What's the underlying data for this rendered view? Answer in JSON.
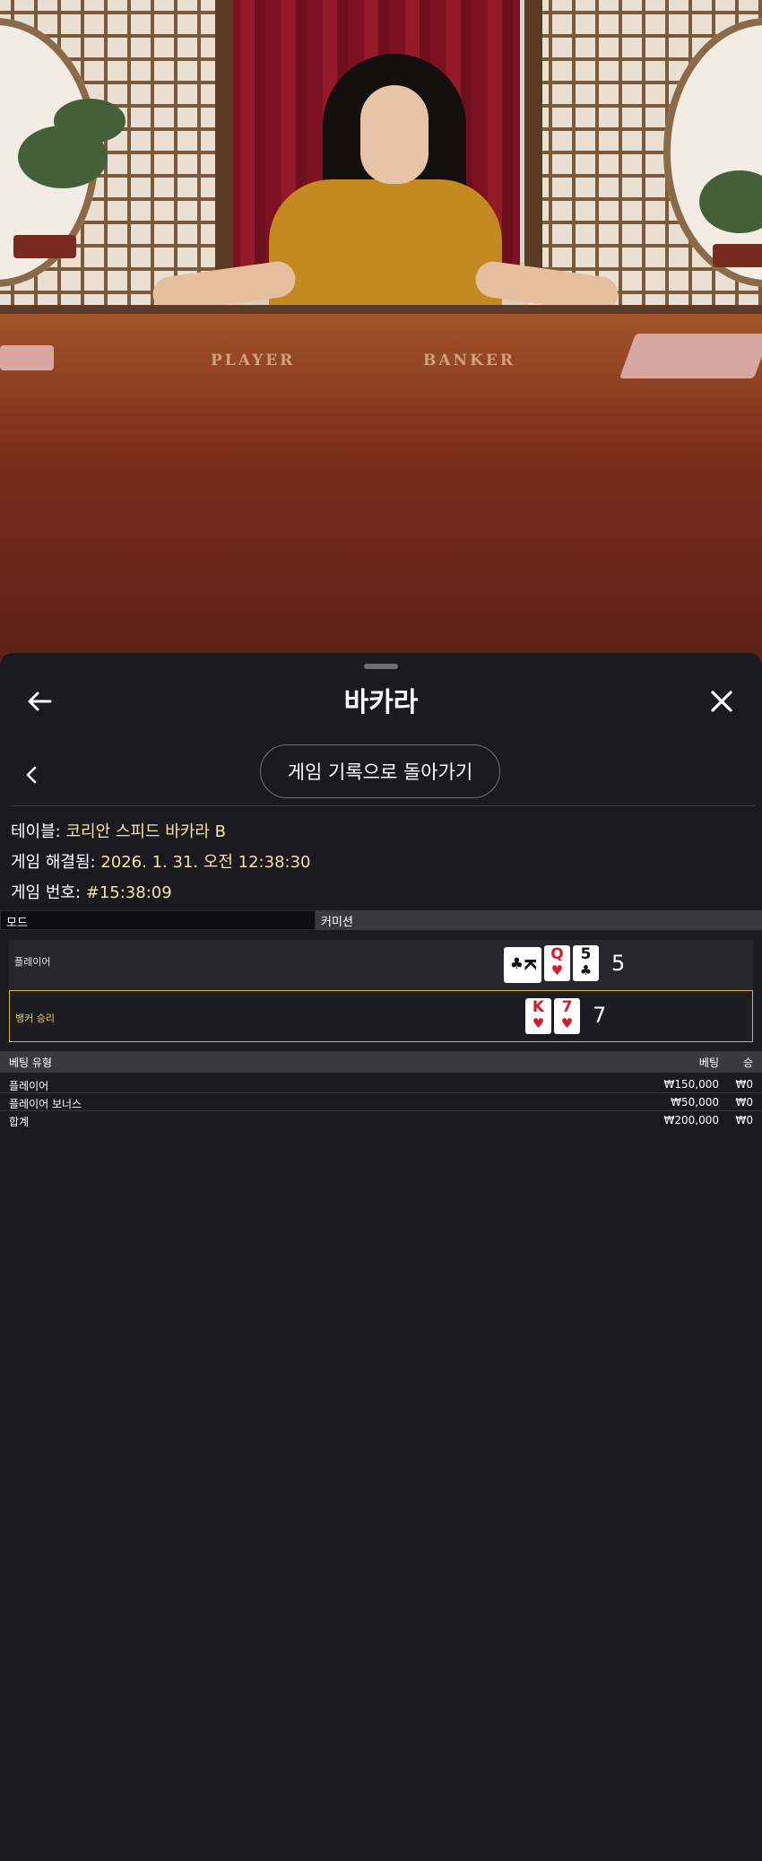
{
  "video": {
    "table_labels": {
      "player": "PLAYER",
      "banker": "BANKER"
    }
  },
  "header": {
    "title": "바카라",
    "back_icon": "arrow-left-icon",
    "close_icon": "close-icon"
  },
  "nav": {
    "prev_icon": "chevron-left-icon",
    "history_button": "게임 기록으로 돌아가기"
  },
  "info": {
    "table_label": "테이블: ",
    "table_value": "코리안 스피드 바카라 B",
    "resolved_label": "게임 해결됨: ",
    "resolved_value": "2026. 1. 31. 오전 12:38:30",
    "number_label": "게임 번호: ",
    "number_value": "#15:38:09"
  },
  "mode": {
    "left": "모드",
    "right": "커미션"
  },
  "results": {
    "player": {
      "label": "플레이어",
      "cards": [
        {
          "rank": "K",
          "suit": "♣",
          "color": "#111111",
          "sideways": true
        },
        {
          "rank": "Q",
          "suit": "♥",
          "color": "#d51d2a"
        },
        {
          "rank": "5",
          "suit": "♣",
          "color": "#111111"
        }
      ],
      "score": "5"
    },
    "banker": {
      "label": "뱅커 승리",
      "cards": [
        {
          "rank": "K",
          "suit": "♥",
          "color": "#d51d2a"
        },
        {
          "rank": "7",
          "suit": "♥",
          "color": "#d51d2a"
        }
      ],
      "score": "7"
    }
  },
  "bets": {
    "columns": {
      "type": "베팅 유형",
      "bet": "베팅",
      "win": "승"
    },
    "rows": [
      {
        "type": "플레이어",
        "bet": "₩150,000",
        "win": "₩0"
      },
      {
        "type": "플레이어 보너스",
        "bet": "₩50,000",
        "win": "₩0"
      },
      {
        "type": "합계",
        "bet": "₩200,000",
        "win": "₩0"
      }
    ]
  },
  "colors": {
    "accent_gold": "#d8b930",
    "value_text": "#f2e3a8",
    "sheet_bg": "#1b1a1e"
  }
}
